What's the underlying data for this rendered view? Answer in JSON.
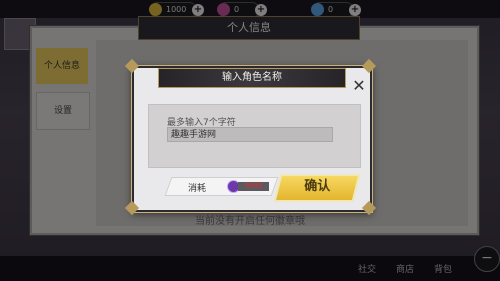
{
  "topbar": {
    "resources": [
      {
        "name": "gold",
        "value": "1000",
        "icon": "gold-coin-icon",
        "color": "#d8b43a"
      },
      {
        "name": "diamond",
        "value": "0",
        "icon": "diamond-icon",
        "color": "#c04d9a"
      },
      {
        "name": "ticket",
        "value": "0",
        "icon": "ticket-icon",
        "color": "#5aa0e0"
      }
    ]
  },
  "panel": {
    "title": "个人信息",
    "tabs": [
      {
        "label": "个人信息",
        "active": true
      },
      {
        "label": "设置",
        "active": false
      }
    ],
    "footer_text": "当前没有开启任何徽章哦"
  },
  "bottom_bar": {
    "items": [
      "社交",
      "商店",
      "背包"
    ]
  },
  "dialog": {
    "title": "输入角色名称",
    "hint": "最多输入7个字符",
    "input_value": "趣趣手游网",
    "cost_label": "消耗",
    "cost_icon": "gem-icon",
    "cost_value": "9999",
    "confirm_label": "确认",
    "close_icon": "close-icon"
  },
  "colors": {
    "accent_gold": "#e8c147",
    "cost_red": "#e03030",
    "frame_gold": "#b69a5c"
  }
}
